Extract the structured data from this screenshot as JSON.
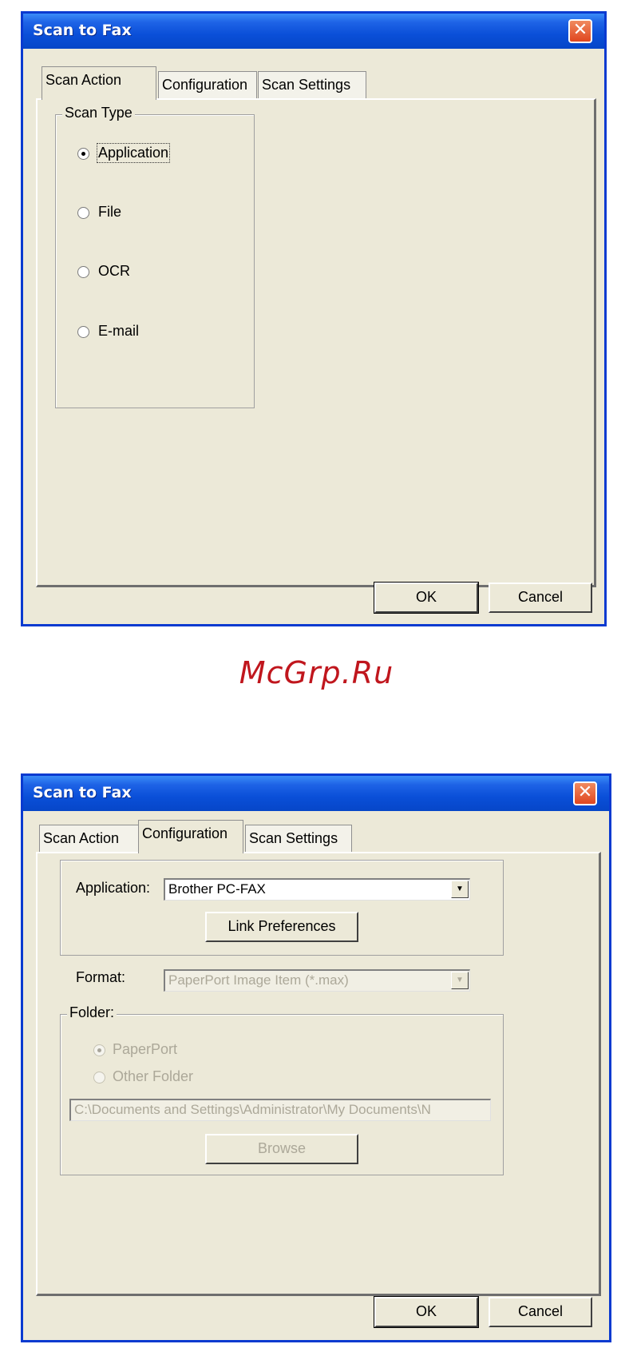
{
  "dialog1": {
    "title": "Scan to Fax",
    "close_glyph": "✕",
    "tabs": [
      {
        "label": "Scan Action",
        "active": true
      },
      {
        "label": "Configuration",
        "active": false
      },
      {
        "label": "Scan Settings",
        "active": false
      }
    ],
    "scan_type": {
      "label": "Scan Type",
      "options": [
        {
          "label": "Application",
          "selected": true
        },
        {
          "label": "File",
          "selected": false
        },
        {
          "label": "OCR",
          "selected": false
        },
        {
          "label": "E-mail",
          "selected": false
        }
      ]
    },
    "ok_label": "OK",
    "cancel_label": "Cancel"
  },
  "watermark": "McGrp.Ru",
  "dialog2": {
    "title": "Scan to Fax",
    "close_glyph": "✕",
    "tabs": [
      {
        "label": "Scan Action",
        "active": false
      },
      {
        "label": "Configuration",
        "active": true
      },
      {
        "label": "Scan Settings",
        "active": false
      }
    ],
    "application_label": "Application:",
    "application_value": "Brother PC-FAX",
    "link_preferences_label": "Link Preferences",
    "format_label": "Format:",
    "format_value": "PaperPort Image Item (*.max)",
    "folder": {
      "label": "Folder:",
      "options": [
        {
          "label": "PaperPort",
          "selected": true
        },
        {
          "label": "Other Folder",
          "selected": false
        }
      ],
      "path": "C:\\Documents and Settings\\Administrator\\My Documents\\N",
      "browse_label": "Browse"
    },
    "ok_label": "OK",
    "cancel_label": "Cancel"
  }
}
